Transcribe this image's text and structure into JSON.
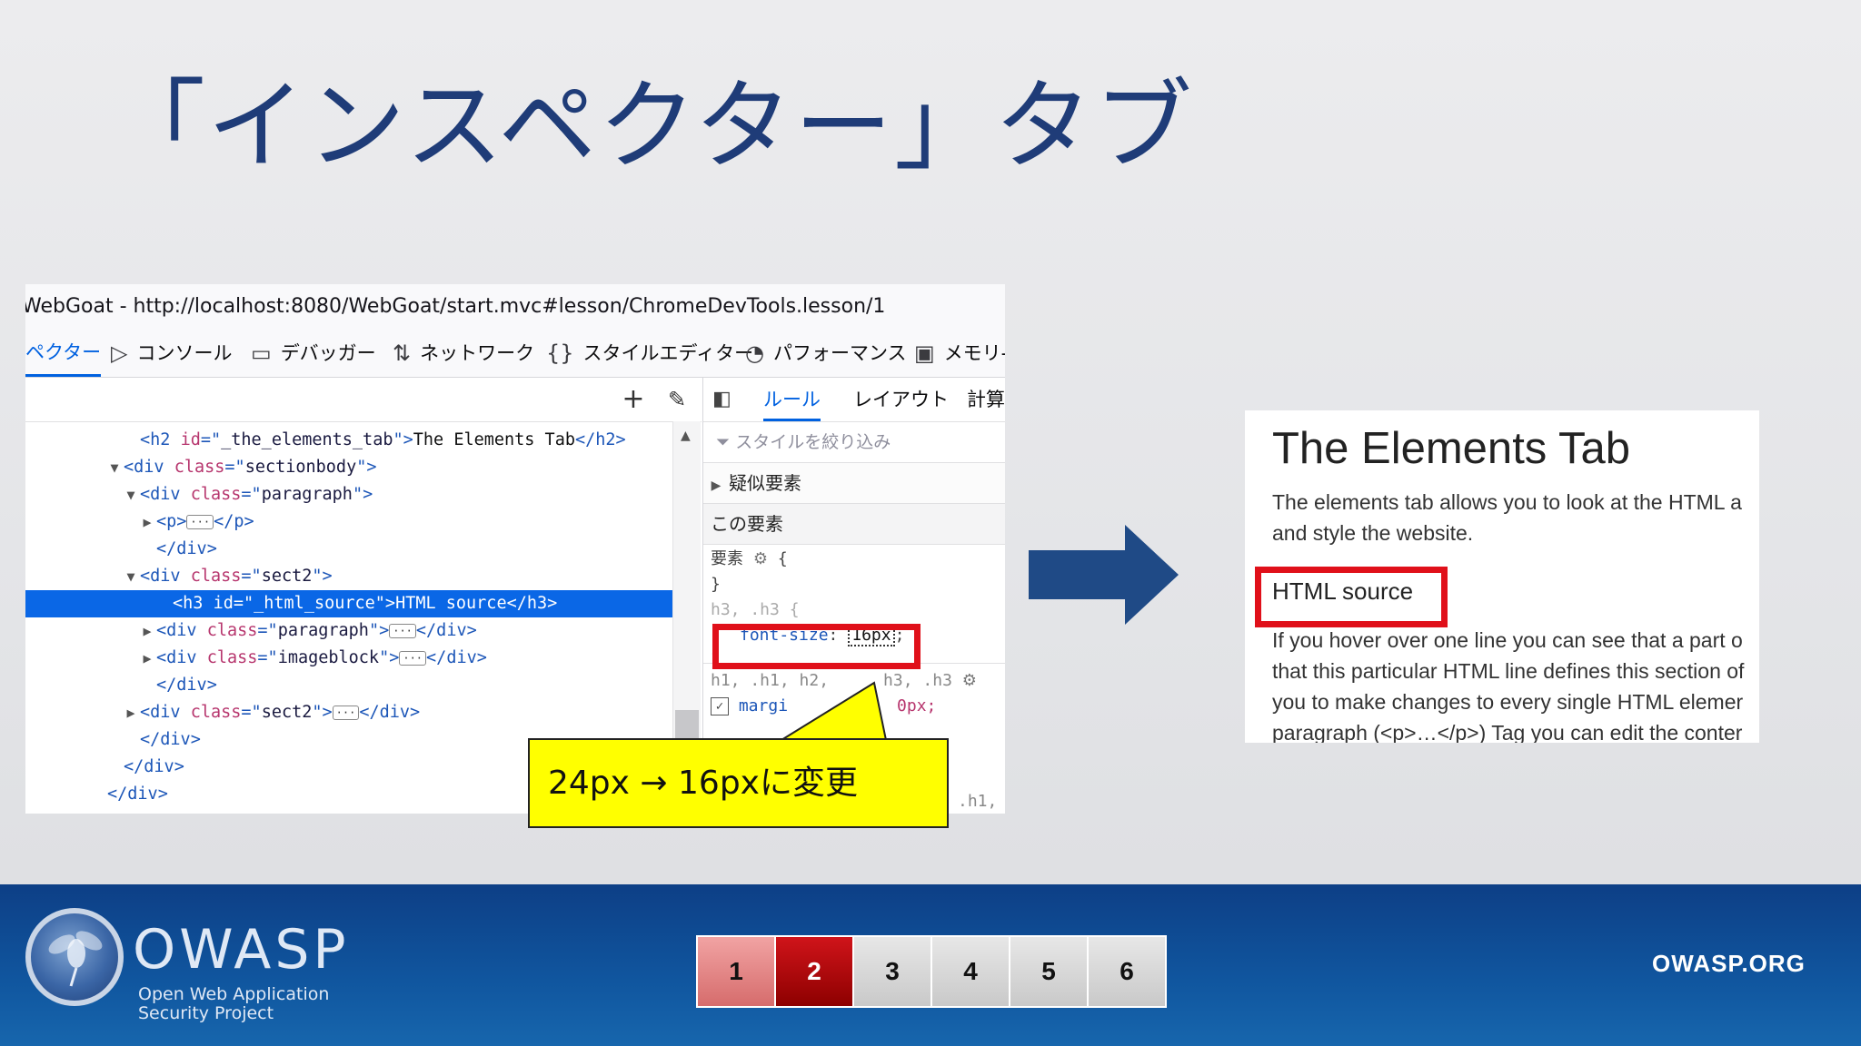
{
  "slide": {
    "title": "「インスペクター」タブ"
  },
  "devtools": {
    "url": "WebGoat - http://localhost:8080/WebGoat/start.mvc#lesson/ChromeDevTools.lesson/1",
    "tabs": [
      {
        "label": "ペクター",
        "icon": "inspector-icon",
        "active": true
      },
      {
        "label": "コンソール",
        "icon": "console-icon"
      },
      {
        "label": "デバッガー",
        "icon": "debugger-icon"
      },
      {
        "label": "ネットワーク",
        "icon": "network-arrows-icon"
      },
      {
        "label": "スタイルエディター",
        "icon": "braces-icon"
      },
      {
        "label": "パフォーマンス",
        "icon": "gauge-icon"
      },
      {
        "label": "メモリ-",
        "icon": "memory-chip-icon"
      }
    ],
    "dom_tree": [
      {
        "indent": 6,
        "tri": "",
        "parts": [
          [
            "tag",
            "<h2 "
          ],
          [
            "attr",
            "id"
          ],
          [
            "tag",
            "=\""
          ],
          [
            "val",
            "_the_elements_tab"
          ],
          [
            "tag",
            "\">"
          ],
          [
            "txt",
            "The Elements Tab"
          ],
          [
            "tag",
            "</h2>"
          ]
        ]
      },
      {
        "indent": 5,
        "tri": "▼",
        "parts": [
          [
            "tag",
            "<div "
          ],
          [
            "attr",
            "class"
          ],
          [
            "tag",
            "=\""
          ],
          [
            "val",
            "sectionbody"
          ],
          [
            "tag",
            "\">"
          ]
        ]
      },
      {
        "indent": 6,
        "tri": "▼",
        "parts": [
          [
            "tag",
            "<div "
          ],
          [
            "attr",
            "class"
          ],
          [
            "tag",
            "=\""
          ],
          [
            "val",
            "paragraph"
          ],
          [
            "tag",
            "\">"
          ]
        ]
      },
      {
        "indent": 7,
        "tri": "▶",
        "parts": [
          [
            "tag",
            "<p>"
          ],
          [
            "ell",
            "···"
          ],
          [
            "tag",
            "</p>"
          ]
        ]
      },
      {
        "indent": 7,
        "tri": "",
        "parts": [
          [
            "tag",
            "</div>"
          ]
        ]
      },
      {
        "indent": 6,
        "tri": "▼",
        "parts": [
          [
            "tag",
            "<div "
          ],
          [
            "attr",
            "class"
          ],
          [
            "tag",
            "=\""
          ],
          [
            "val",
            "sect2"
          ],
          [
            "tag",
            "\">"
          ]
        ]
      },
      {
        "indent": 8,
        "tri": "",
        "selected": true,
        "parts": [
          [
            "tag",
            "<h3 "
          ],
          [
            "attr",
            "id"
          ],
          [
            "tag",
            "=\""
          ],
          [
            "val",
            "_html_source"
          ],
          [
            "tag",
            "\">"
          ],
          [
            "txt",
            "HTML source"
          ],
          [
            "tag",
            "</h3>"
          ]
        ]
      },
      {
        "indent": 7,
        "tri": "▶",
        "parts": [
          [
            "tag",
            "<div "
          ],
          [
            "attr",
            "class"
          ],
          [
            "tag",
            "=\""
          ],
          [
            "val",
            "paragraph"
          ],
          [
            "tag",
            "\">"
          ],
          [
            "ell",
            "···"
          ],
          [
            "tag",
            "</div>"
          ]
        ]
      },
      {
        "indent": 7,
        "tri": "▶",
        "parts": [
          [
            "tag",
            "<div "
          ],
          [
            "attr",
            "class"
          ],
          [
            "tag",
            "=\""
          ],
          [
            "val",
            "imageblock"
          ],
          [
            "tag",
            "\">"
          ],
          [
            "ell",
            "···"
          ],
          [
            "tag",
            "</div>"
          ]
        ]
      },
      {
        "indent": 7,
        "tri": "",
        "parts": [
          [
            "tag",
            "</div>"
          ]
        ]
      },
      {
        "indent": 6,
        "tri": "▶",
        "parts": [
          [
            "tag",
            "<div "
          ],
          [
            "attr",
            "class"
          ],
          [
            "tag",
            "=\""
          ],
          [
            "val",
            "sect2"
          ],
          [
            "tag",
            "\">"
          ],
          [
            "ell",
            "···"
          ],
          [
            "tag",
            "</div>"
          ]
        ]
      },
      {
        "indent": 6,
        "tri": "",
        "parts": [
          [
            "tag",
            "</div>"
          ]
        ]
      },
      {
        "indent": 5,
        "tri": "",
        "parts": [
          [
            "tag",
            "</div>"
          ]
        ]
      },
      {
        "indent": 4,
        "tri": "",
        "parts": [
          [
            "tag",
            "</div>"
          ]
        ]
      }
    ],
    "rules": {
      "tabs": [
        "ルール",
        "レイアウト",
        "計算"
      ],
      "filter_placeholder": "スタイルを絞り込み",
      "pseudo_label": "疑似要素",
      "this_element_label": "この要素",
      "element_rule_selector": "要素",
      "open_brace": "{",
      "close_brace": "}",
      "h3_rule_selector": "h3, .h3",
      "prop_name": "font-size",
      "prop_value": "16px",
      "semicolon": ";",
      "next_selector": "h1, .h1, h2,",
      "next_selector_tail": "h3, .h3",
      "next_prop": "margi",
      "next_value": "0px;",
      "bottom_frag": ".h1,"
    }
  },
  "callout": {
    "text": "24px → 16pxに変更"
  },
  "webpage": {
    "title": "The Elements Tab",
    "para1_line1": "The elements tab allows you to look at the HTML a",
    "para1_line2": "and style the website.",
    "h3": "HTML source",
    "para2_lines": [
      "If you hover over one line you can see that a part o",
      "that this particular HTML line defines this section of",
      "you to make changes to every single HTML elemer",
      "paragraph (<p>…</p>) Tag you can edit the conter"
    ]
  },
  "footer": {
    "logo_text": "OWASP",
    "logo_sub_line1": "Open Web Application",
    "logo_sub_line2": "Security Project",
    "pages": [
      "1",
      "2",
      "3",
      "4",
      "5",
      "6"
    ],
    "current_page": "2",
    "site": "OWASP.ORG"
  },
  "colors": {
    "title": "#1f3c78",
    "highlight_red": "#e0101a",
    "callout_yellow": "#ffff00",
    "footer_blue": "#10569f",
    "arrow_navy": "#1f4a86"
  }
}
